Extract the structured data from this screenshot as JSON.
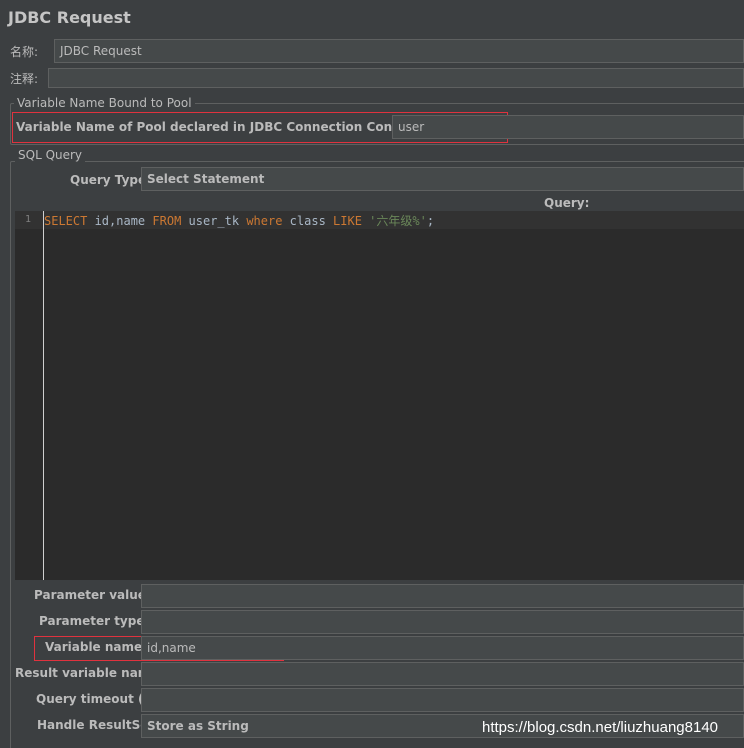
{
  "window": {
    "title": "JDBC Request"
  },
  "name_row": {
    "label": "名称:",
    "value": "JDBC Request"
  },
  "comment_row": {
    "label": "注释:",
    "value": ""
  },
  "pool_group": {
    "legend": "Variable Name Bound to Pool",
    "label": "Variable Name of Pool declared in JDBC Connection Configuration:",
    "value": "user"
  },
  "sql_group": {
    "legend": "SQL Query",
    "query_type_label": "Query Type:",
    "query_type_value": "Select Statement",
    "query_header": "Query:",
    "line_number": "1",
    "code": {
      "t1": "SELECT",
      "t2": " id,name ",
      "t3": "FROM",
      "t4": " user_tk ",
      "t5": "where",
      "t6": " class ",
      "t7": "LIKE",
      "t8": " ",
      "t9": "'六年级%'",
      "t10": ";"
    }
  },
  "params": {
    "parameter_values": {
      "label": "Parameter values:",
      "value": ""
    },
    "parameter_types": {
      "label": "Parameter types:",
      "value": ""
    },
    "variable_names": {
      "label": "Variable names:",
      "value": "id,name"
    },
    "result_variable_name": {
      "label": "Result variable name:",
      "value": ""
    },
    "query_timeout": {
      "label": "Query timeout (s):",
      "value": ""
    },
    "handle_resultset": {
      "label": "Handle ResultSet:",
      "value": "Store as String"
    }
  },
  "watermark": "https://blog.csdn.net/liuzhuang8140",
  "colors": {
    "background": "#3c3f41",
    "editor_background": "#2b2b2b",
    "highlight_border": "#e0323e",
    "sql_keyword": "#cc7832",
    "sql_string": "#6a8759"
  }
}
